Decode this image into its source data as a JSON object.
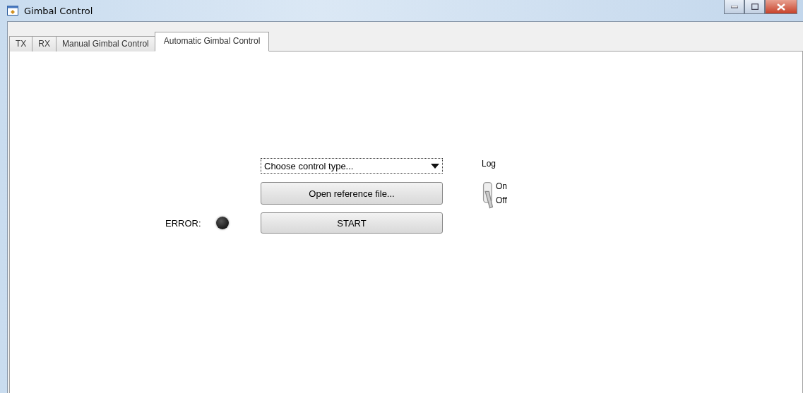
{
  "window": {
    "title": "Gimbal Control"
  },
  "tabs": [
    {
      "label": "TX",
      "selected": false
    },
    {
      "label": "RX",
      "selected": false
    },
    {
      "label": "Manual Gimbal Control",
      "selected": false
    },
    {
      "label": "Automatic Gimbal Control",
      "selected": true
    }
  ],
  "control_type": {
    "placeholder": "Choose control type..."
  },
  "open_button": "Open reference file...",
  "error": {
    "label": "ERROR:",
    "lit": false
  },
  "start_button": "START",
  "log": {
    "label": "Log",
    "on_label": "On",
    "off_label": "Off",
    "on": false
  }
}
